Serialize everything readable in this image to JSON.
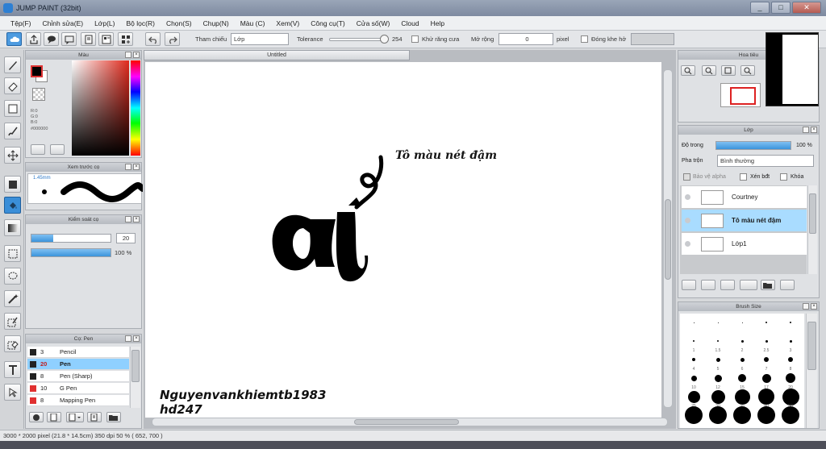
{
  "window": {
    "title": "JUMP PAINT (32bit)",
    "min": "_",
    "max": "□",
    "close": "✕"
  },
  "menu": [
    "Tệp(F)",
    "Chỉnh sửa(E)",
    "Lớp(L)",
    "Bộ lọc(R)",
    "Chọn(S)",
    "Chụp(N)",
    "Màu (C)",
    "Xem(V)",
    "Công cụ(T)",
    "Cửa số(W)",
    "Cloud",
    "Help"
  ],
  "toolbar": {
    "ref_label": "Tham chiếu",
    "ref_value": "Lớp",
    "tolerance_label": "Tolerance",
    "tolerance_value": "254",
    "tolerance_fraction": 0.996,
    "antialias_label": "Khử răng cưa",
    "expand_label": "Mở rộng",
    "expand_value": "0",
    "expand_unit": "pixel",
    "close_gap_label": "Đóng khe hở"
  },
  "color_panel": {
    "title": "Màu",
    "r": "R:0",
    "g": "G:0",
    "b": "B:0",
    "hex": "#000000",
    "foreground": "#000000",
    "background": "#ffffff",
    "hue": "#e02a1d"
  },
  "brush_preview": {
    "title": "Xem trước cọ",
    "size": "1.45mm"
  },
  "brush_control": {
    "title": "Kiểm soát cọ",
    "size_value": "20",
    "size_fraction": 0.28,
    "opacity_value": "100 %",
    "opacity_fraction": 1.0
  },
  "brush_list": {
    "title": "Cọ: Pen",
    "items": [
      {
        "size": "3",
        "name": "Pencil",
        "color": "#222222"
      },
      {
        "size": "20",
        "name": "Pen",
        "color": "#222222"
      },
      {
        "size": "8",
        "name": "Pen (Sharp)",
        "color": "#222222"
      },
      {
        "size": "10",
        "name": "G Pen",
        "color": "#e03030"
      },
      {
        "size": "8",
        "name": "Mapping Pen",
        "color": "#e03030"
      }
    ]
  },
  "canvas": {
    "tab": "Untitled",
    "stroke_label": "Tô màu nét đậm",
    "signature_line1": "Nguyenvankhiemtb1983",
    "signature_line2": "hd247"
  },
  "navigator": {
    "title": "Hoa tiêu"
  },
  "layers": {
    "title": "Lớp",
    "opacity_label": "Độ trong",
    "opacity_value": "100 %",
    "blend_label": "Pha trộn",
    "blend_value": "Bình thường",
    "protect_alpha": "Bảo vệ alpha",
    "clipping": "Xén bđt",
    "lock": "Khóa",
    "items": [
      {
        "name": "Courtney"
      },
      {
        "name": "Tô màu nét đậm"
      },
      {
        "name": "Lớp1"
      }
    ]
  },
  "brush_size": {
    "title": "Brush Size",
    "labels": [
      "",
      "",
      "",
      "",
      "",
      "1",
      "1.5",
      "2",
      "2.5",
      "3",
      "4",
      "5",
      "6",
      "7",
      "8",
      "10",
      "12",
      "15",
      "17",
      "20",
      "25",
      "30",
      "35",
      "40",
      "50",
      "",
      "",
      "",
      "",
      ""
    ]
  },
  "status": "3000 * 2000 pixel  (21.8 * 14.5cm)  350 dpi  50 %  ( 652, 700 )"
}
